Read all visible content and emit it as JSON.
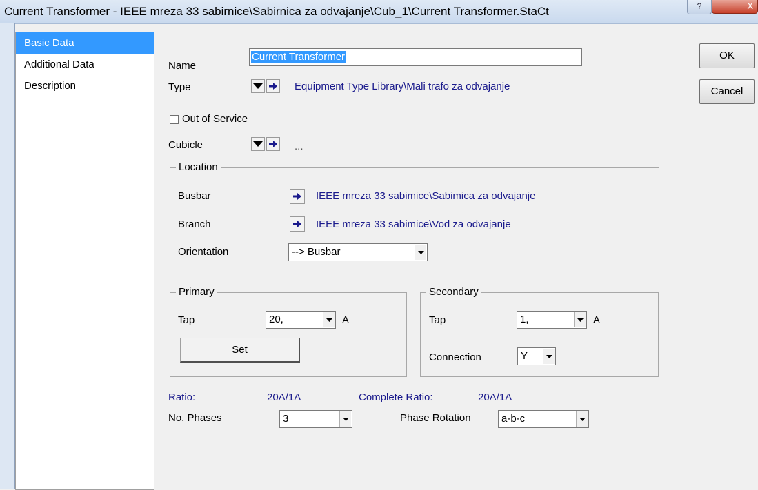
{
  "window": {
    "title": "Current Transformer - IEEE mreza 33 sabirnice\\Sabirnica za odvajanje\\Cub_1\\Current Transformer.StaCt",
    "help_glyph": "?",
    "close_glyph": "X"
  },
  "nav": {
    "items": [
      {
        "label": "Basic Data",
        "active": true
      },
      {
        "label": "Additional Data",
        "active": false
      },
      {
        "label": "Description",
        "active": false
      }
    ]
  },
  "form": {
    "name_label": "Name",
    "name_value": "Current Transformer",
    "type_label": "Type",
    "type_value": "Equipment Type Library\\Mali trafo za odvajanje",
    "out_of_service_label": "Out of Service",
    "out_of_service_checked": false,
    "cubicle_label": "Cubicle",
    "cubicle_value": "..."
  },
  "location": {
    "title": "Location",
    "busbar_label": "Busbar",
    "busbar_value": "IEEE mreza 33 sabimice\\Sabimica za odvajanje",
    "branch_label": "Branch",
    "branch_value": "IEEE mreza 33 sabimice\\Vod za odvajanje",
    "orientation_label": "Orientation",
    "orientation_value": "--> Busbar"
  },
  "primary": {
    "title": "Primary",
    "tap_label": "Tap",
    "tap_value": "20,",
    "unit": "A",
    "set_label": "Set"
  },
  "secondary": {
    "title": "Secondary",
    "tap_label": "Tap",
    "tap_value": "1,",
    "unit": "A",
    "connection_label": "Connection",
    "connection_value": "Y"
  },
  "ratio": {
    "ratio_label": "Ratio:",
    "ratio_value": "20A/1A",
    "complete_label": "Complete Ratio:",
    "complete_value": "20A/1A",
    "phases_label": "No. Phases",
    "phases_value": "3",
    "rotation_label": "Phase Rotation",
    "rotation_value": "a-b-c"
  },
  "buttons": {
    "ok": "OK",
    "cancel": "Cancel"
  },
  "colors": {
    "selection": "#3399ff",
    "link_text": "#1a1a8c"
  }
}
